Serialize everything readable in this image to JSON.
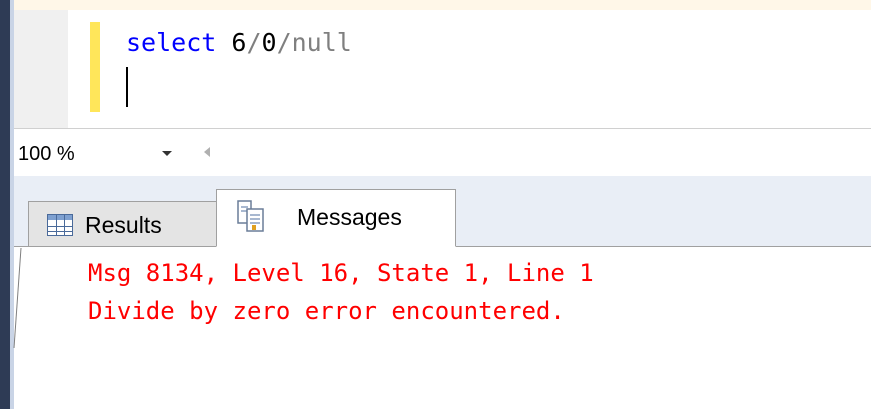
{
  "editor": {
    "code": {
      "keyword": "select",
      "numerator": "6",
      "divisor": "0",
      "operand": "null",
      "op1": "/",
      "op2": "/"
    }
  },
  "zoom": {
    "value": "100 %"
  },
  "tabs": [
    {
      "label": "Results",
      "icon": "grid-icon",
      "active": false
    },
    {
      "label": "Messages",
      "icon": "messages-icon",
      "active": true
    }
  ],
  "messages": {
    "lines": [
      "Msg 8134, Level 16, State 1, Line 1",
      "Divide by zero error encountered."
    ]
  },
  "colors": {
    "keyword": "#0000ff",
    "operator": "#7f7f7f",
    "error": "#ff0000",
    "change_bar": "#ffe65a"
  }
}
